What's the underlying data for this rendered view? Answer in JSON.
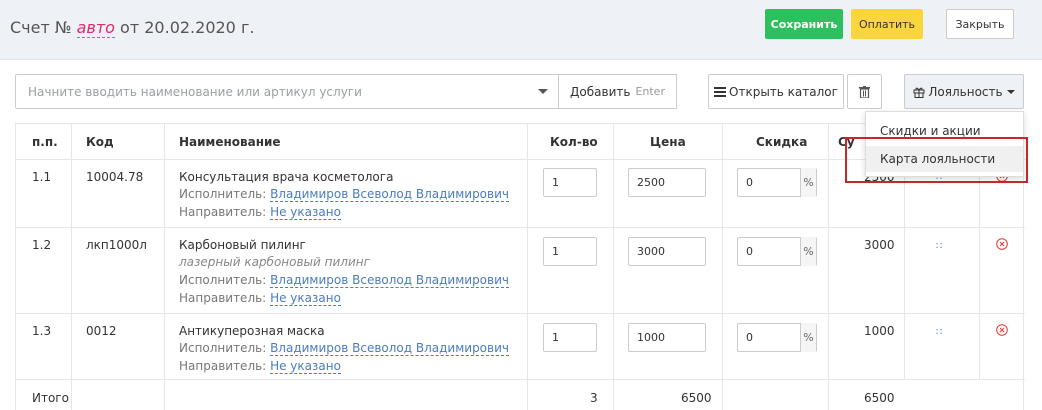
{
  "header": {
    "title_prefix": "Счет №",
    "title_auto": "авто",
    "title_suffix": "от 20.02.2020 г.",
    "save_label": "Сохранить",
    "pay_label": "Оплатить",
    "close_label": "Закрыть"
  },
  "toolbar": {
    "search_placeholder": "Начните вводить наименование или артикул услуги",
    "add_label": "Добавить",
    "add_hint": "Enter",
    "catalog_label": "Открыть каталог",
    "loyalty_label": "Лояльность"
  },
  "dropdown": {
    "items": [
      "Скидки и акции",
      "Карта лояльности"
    ]
  },
  "table": {
    "columns": [
      "п.п.",
      "Код",
      "Наименование",
      "Кол-во",
      "Цена",
      "Скидка",
      "Су"
    ],
    "executor_label": "Исполнитель:",
    "director_label": "Направитель:",
    "rows": [
      {
        "num": "1.1",
        "code": "10004.78",
        "name": "Консультация врача косметолога",
        "note": "",
        "executor": "Владимиров Всеволод Владимирович",
        "director": "Не указано",
        "qty": "1",
        "price": "2500",
        "discount": "0",
        "sum": "2500"
      },
      {
        "num": "1.2",
        "code": "лкп1000л",
        "name": "Карбоновый пилинг",
        "note": "лазерный карбоновый пилинг",
        "executor": "Владимиров Всеволод Владимирович",
        "director": "Не указано",
        "qty": "1",
        "price": "3000",
        "discount": "0",
        "sum": "3000"
      },
      {
        "num": "1.3",
        "code": "0012",
        "name": "Антикуперозная маска",
        "note": "",
        "executor": "Владимиров Всеволод Владимирович",
        "director": "Не указано",
        "qty": "1",
        "price": "1000",
        "discount": "0",
        "sum": "1000"
      }
    ],
    "total": {
      "label": "Итого",
      "qty": "3",
      "price": "6500",
      "sum": "6500"
    },
    "percent_sign": "%"
  }
}
